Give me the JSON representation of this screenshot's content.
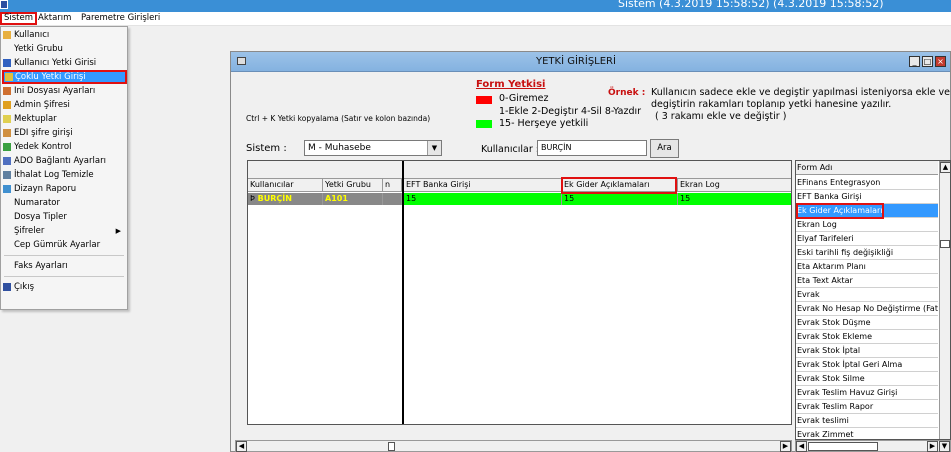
{
  "titlebar": {
    "text": "Sistem (4.3.2019 15:58:52) (4.3.2019 15:58:52)"
  },
  "menubar": {
    "items": [
      "Sistem",
      "Aktarım",
      "Paremetre Girişleri"
    ]
  },
  "sistem_menu": {
    "items": [
      "Kullanıcı",
      "Yetki Grubu",
      "Kullanıcı Yetki Girisi",
      "Çoklu Yetki Girişi",
      "Ini Dosyası Ayarları",
      "Admin Şifresi",
      "Mektuplar",
      "EDI şifre girişi",
      "Yedek Kontrol",
      "ADO Bağlantı Ayarları",
      "İthalat Log Temizle",
      "Dizayn Raporu",
      "Numarator",
      "Dosya Tipler",
      "Şifreler",
      "Cep Gümrük Ayarlar",
      "Faks Ayarları",
      "Çıkış"
    ]
  },
  "window": {
    "title": "YETKİ GİRİŞLERİ",
    "copy_hint": "Ctrl + K Yetki kopyalama (Satır ve kolon bazında)",
    "sistem_label": "Sistem :",
    "sistem_value": "M - Muhasebe",
    "kullanicilar_label": "Kullanıcılar :",
    "kullanicilar_value": "BURÇİN",
    "ara_button": "Ara",
    "form_yetkisi": {
      "title": "Form Yetkisi",
      "legend": [
        "0-Giremez",
        "1-Ekle  2-Degiştır  4-Sil  8-Yazdır",
        "15- Herşeye yetkili"
      ],
      "colors": [
        "#ff0000",
        "#00ff00"
      ]
    },
    "ornek_label": "Örnek :",
    "ornek_text": [
      "Kullanıcın sadece ekle ve degiştir yapılmasi isteniyorsa  ekle ve",
      "degiştirin rakamları toplanıp yetki hanesine yazılır.",
      "( 3 rakamı ekle ve değiştir )"
    ]
  },
  "grid": {
    "columns": [
      "Kullanıcılar",
      "Yetki Grubu",
      "n",
      "EFT Banka Girişi",
      "Ek Gider Açıklamaları",
      "Ekran Log"
    ],
    "row": [
      "BURÇİN",
      "A101",
      "",
      "15",
      "15",
      "15"
    ],
    "row_marker": "Þ"
  },
  "form_list": {
    "header": "Form Adı",
    "items": [
      "EFinans Entegrasyon",
      "EFT Banka Girişi",
      "Ek Gider Açıklamaları",
      "Ekran Log",
      "Elyaf Tarifeleri",
      "Eski tarihli fiş değişikliği",
      "Eta Aktarım Planı",
      "Eta Text Aktar",
      "Evrak",
      "Evrak No Hesap No Değiştirme (Fatura",
      "Evrak Stok Düşme",
      "Evrak Stok Ekleme",
      "Evrak Stok İptal",
      "Evrak Stok İptal Geri Alma",
      "Evrak Stok Silme",
      "Evrak Teslim Havuz Girişi",
      "Evrak Teslim Rapor",
      "Evrak teslimi",
      "Evrak Zimmet"
    ],
    "selected_index": 2
  }
}
